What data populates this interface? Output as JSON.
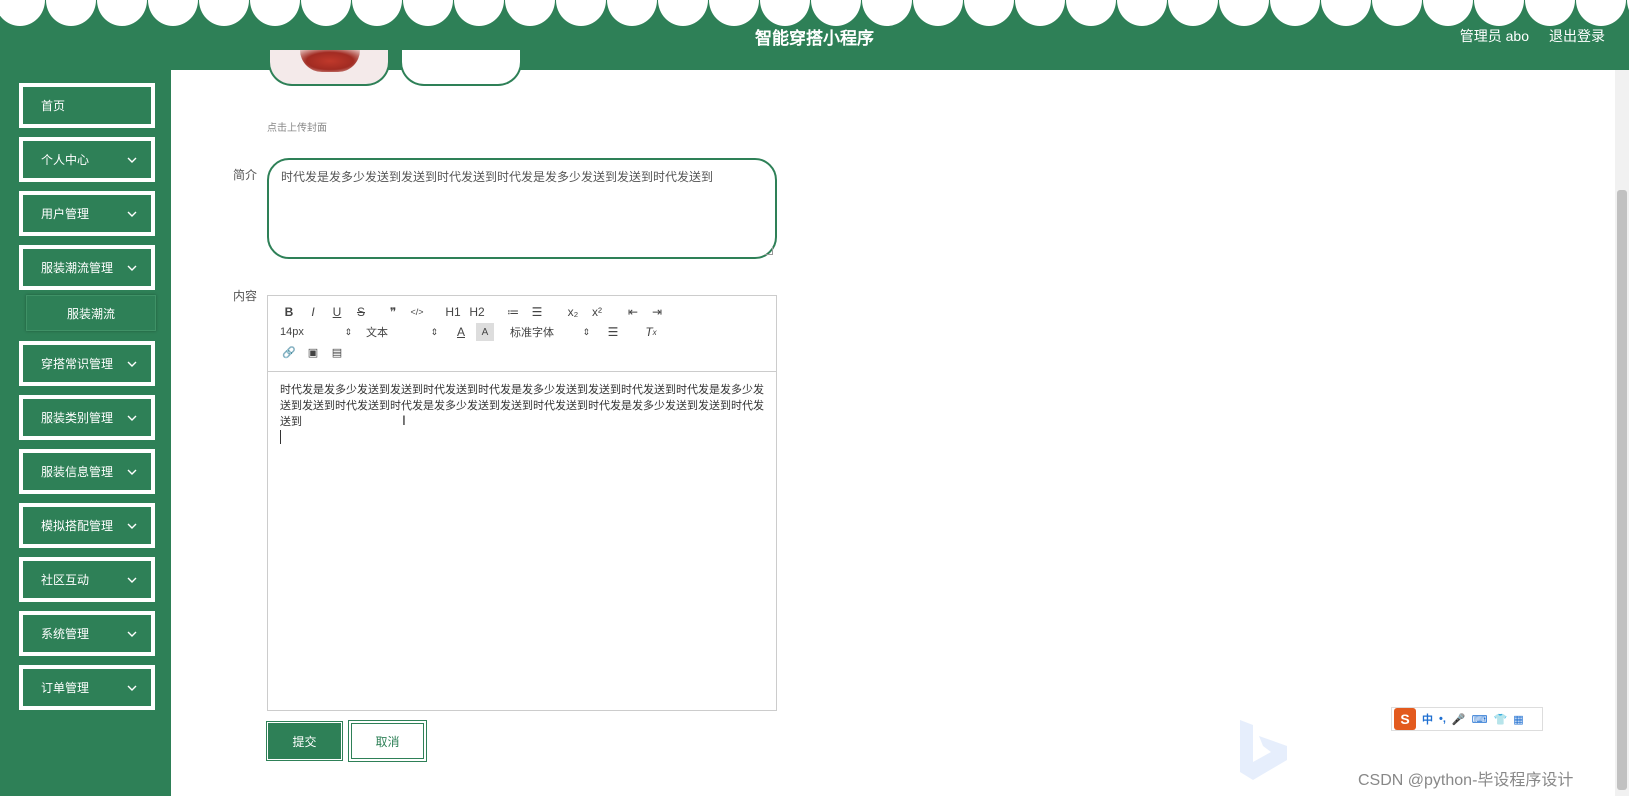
{
  "header": {
    "title": "智能穿搭小程序",
    "admin_label": "管理员 abo",
    "logout_label": "退出登录"
  },
  "sidebar": {
    "items": [
      {
        "label": "首页",
        "has_arrow": false
      },
      {
        "label": "个人中心",
        "has_arrow": true
      },
      {
        "label": "用户管理",
        "has_arrow": true
      },
      {
        "label": "服装潮流管理",
        "has_arrow": true
      },
      {
        "label": "穿搭常识管理",
        "has_arrow": true
      },
      {
        "label": "服装类别管理",
        "has_arrow": true
      },
      {
        "label": "服装信息管理",
        "has_arrow": true
      },
      {
        "label": "模拟搭配管理",
        "has_arrow": true
      },
      {
        "label": "社区互动",
        "has_arrow": true
      },
      {
        "label": "系统管理",
        "has_arrow": true
      },
      {
        "label": "订单管理",
        "has_arrow": true
      }
    ],
    "sub_item": "服装潮流"
  },
  "form": {
    "cover_hint": "点击上传封面",
    "summary_label": "简介",
    "summary_value": "时代发是发多少发送到发送到时代发送到时代发是发多少发送到发送到时代发送到",
    "content_label": "内容",
    "content_value": "时代发是发多少发送到发送到时代发送到时代发是发多少发送到发送到时代发送到时代发是发多少发送到发送到时代发送到时代发是发多少发送到发送到时代发送到时代发是发多少发送到发送到时代发送到",
    "submit_label": "提交",
    "cancel_label": "取消"
  },
  "toolbar": {
    "row1": [
      {
        "name": "bold-icon",
        "glyph": "B"
      },
      {
        "name": "italic-icon",
        "glyph": "I"
      },
      {
        "name": "underline-icon",
        "glyph": "U"
      },
      {
        "name": "strike-icon",
        "glyph": "S"
      },
      {
        "name": "blockquote-icon",
        "glyph": "❞"
      },
      {
        "name": "code-block-icon",
        "glyph": "</>"
      },
      {
        "name": "h1-icon",
        "glyph": "H1"
      },
      {
        "name": "h2-icon",
        "glyph": "H2"
      },
      {
        "name": "ordered-list-icon",
        "glyph": "≔"
      },
      {
        "name": "bullet-list-icon",
        "glyph": "☰"
      },
      {
        "name": "subscript-icon",
        "glyph": "x₂"
      },
      {
        "name": "superscript-icon",
        "glyph": "x²"
      },
      {
        "name": "outdent-icon",
        "glyph": "⇤"
      },
      {
        "name": "indent-icon",
        "glyph": "⇥"
      }
    ],
    "size_value": "14px",
    "header_value": "文本",
    "font_value": "标准字体",
    "row3": [
      {
        "name": "link-icon",
        "glyph": "🔗"
      },
      {
        "name": "image-icon",
        "glyph": "▣"
      },
      {
        "name": "video-icon",
        "glyph": "▤"
      }
    ]
  },
  "ime": {
    "lang": "中",
    "punct": "•,"
  },
  "watermark": "CSDN @python-毕设程序设计",
  "colors": {
    "primary": "#2e8057",
    "white": "#ffffff"
  }
}
